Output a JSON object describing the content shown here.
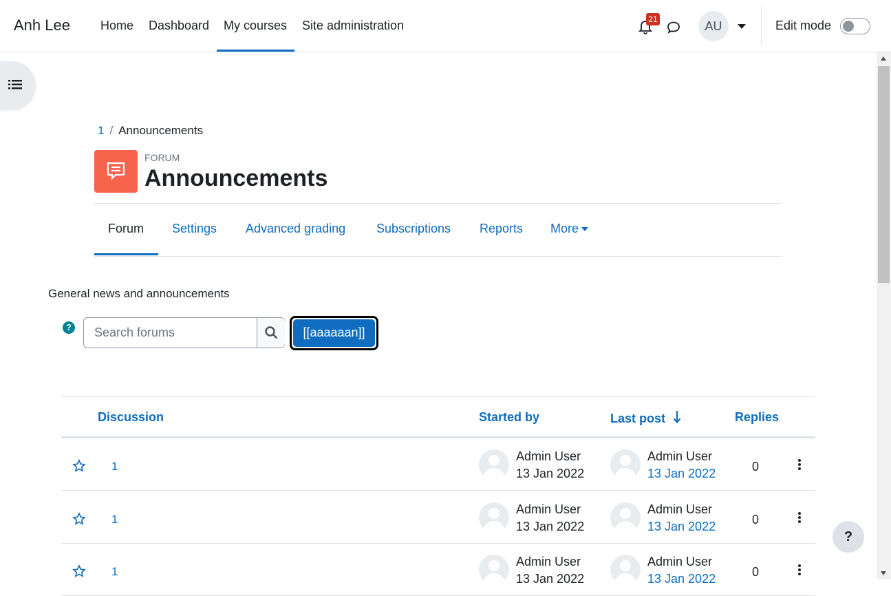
{
  "navbar": {
    "brand": "Anh Lee",
    "links": [
      "Home",
      "Dashboard",
      "My courses",
      "Site administration"
    ],
    "active_link": "My courses",
    "notification_count": "21",
    "avatar_initials": "AU",
    "edit_mode_label": "Edit mode",
    "edit_mode_on": false
  },
  "breadcrumb": {
    "course": "1",
    "current": "Announcements"
  },
  "header": {
    "module_type": "FORUM",
    "title": "Announcements",
    "icon_color": "#f7634d"
  },
  "tabs": {
    "items": [
      "Forum",
      "Settings",
      "Advanced grading",
      "Subscriptions",
      "Reports",
      "More"
    ],
    "active": "Forum"
  },
  "intro": "General news and announcements",
  "search": {
    "placeholder": "Search forums"
  },
  "add_button_label": "[[aaaaaan]]",
  "table": {
    "headers": {
      "discussion": "Discussion",
      "started_by": "Started by",
      "last_post": "Last post",
      "replies": "Replies"
    },
    "rows": [
      {
        "title": "1",
        "started_by": "Admin User",
        "started_date": "13 Jan 2022",
        "last_by": "Admin User",
        "last_date": "13 Jan 2022",
        "replies": "0"
      },
      {
        "title": "1",
        "started_by": "Admin User",
        "started_date": "13 Jan 2022",
        "last_by": "Admin User",
        "last_date": "13 Jan 2022",
        "replies": "0"
      },
      {
        "title": "1",
        "started_by": "Admin User",
        "started_date": "13 Jan 2022",
        "last_by": "Admin User",
        "last_date": "13 Jan 2022",
        "replies": "0"
      }
    ]
  },
  "help_button": "?",
  "colors": {
    "primary": "#0f6cbf",
    "danger": "#ca3120",
    "forum_icon": "#f7634d",
    "help_icon": "#008196"
  }
}
